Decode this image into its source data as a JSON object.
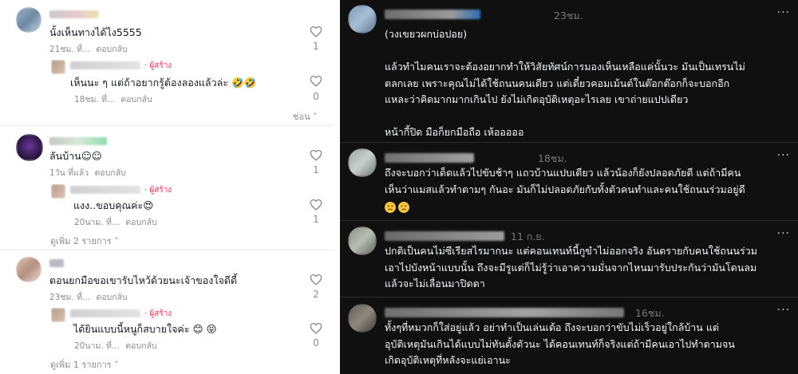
{
  "left_panel": {
    "comments": [
      {
        "username_blurred": true,
        "text": "นั้งเห็นทางได้ไง5555",
        "time": "21ชม. ที่...",
        "reply_label": "ตอบกลับ",
        "likes": "1",
        "replies": [
          {
            "creator_badge": "· ผู้สร้าง",
            "text": "เห็นนะ ๆ แต่ถ้าอยากรู้ต้องลองแล้วล่ะ 🤣🤣",
            "time": "18ชม. ที่...",
            "reply_label": "ตอบกลับ",
            "likes": "0"
          }
        ],
        "hide_label": "ซ่อน ˄"
      },
      {
        "username_blurred": true,
        "text": "ลันบ้าน☺☺",
        "time": "1วัน ที่แล้ว",
        "reply_label": "ตอบกลับ",
        "likes": "1",
        "replies": [
          {
            "creator_badge": "· ผู้สร้าง",
            "text": "แงง..ขอบคุณค่ะ😍",
            "time": "20นาม. ที่...",
            "reply_label": "ตอบกลับ",
            "likes": "1"
          }
        ],
        "more_label": "ดูเพิ่ม 2 รายการ ˅"
      },
      {
        "username_blurred": true,
        "text": "ตอนยกมือขอเขารับไหว้ด้วยนะเจ้าของใจดีดี้",
        "time": "23ชม. ที่...",
        "reply_label": "ตอบกลับ",
        "likes": "2",
        "replies": [
          {
            "creator_badge": "· ผู้สร้าง",
            "text": "ได้ยินแบบนี้หนูก็สบายใจค่ะ 😊 😝",
            "time": "20นาม. ที่...",
            "reply_label": "ตอบกลับ",
            "likes": "0"
          }
        ],
        "more_label": "ดูเพิ่ม 1 รายการ ˅"
      }
    ]
  },
  "right_panel": {
    "posts": [
      {
        "time": "23ชม.",
        "more": "···",
        "lines": [
          "(วงเขยวผกบ่อปอย)",
          "",
          "แล้วทำไมคนเราจะต้องอยากทำให้วิสัยทัศน์การมองเห็นเหลือแค่นั้นวะ มันเป็นเทรนไม่",
          "ตลกเลย เพราะคุณไม่ได้ใช้ถนนคนเดียว แต่เดี๋ยวคอมเม้นต์ในต๊อกต๊อกก็จะบอกอีก",
          "แหละว่าคิดมากมากเกินไป ยังไม่เกิดอุบัติเหตุอะไรเลย เขาถ่ายแปปเดียว",
          "",
          "หน้ากี้ปิด มือก็ยกมือถือ เห้อออออ"
        ]
      },
      {
        "time": "18ชม.",
        "more": "···",
        "lines": [
          "ถึงจะบอกว่าเด็ดแล้วไปขับช้าๆ แถวบ้านแปบเดียว แล้วน้องก็ยังปลอดภัยดี แต่ถ้ามีคน",
          "เห็นว่าแมสแล้วทำตามๆ กันอะ มันก็ไม่ปลอดภัยกับทั้งตัวคนทำและคนใช้ถนนร่วมอยู่ดี"
        ],
        "emoji_count": 2
      },
      {
        "time": "11 ก.ย.",
        "more": "···",
        "lines": [
          "ปกติเป็นคนไม่ซีเรียสไรมากนะ แต่คอนเทนท์นี้กูขำไม่ออกจริง อันตรายกับคนใช้ถนนร่วม",
          "เอาไปบังหน้าแบบนั้น ถึงจะมีรูแต่ก็ไม่รู้ว่าเอาความมั่นจากไหนมารับประกันว่ามันโดนลม",
          "แล้วจะไม่เลื่อนมาปิดตา"
        ]
      },
      {
        "time": "16ชม.",
        "more": "···",
        "lines": [
          "ทั้งๆที่หมวกก็ใส่อยู่แล้ว อย่าทำเป็นเล่นเด้อ ถึงจะบอกว่าขับไม่เร็วอยู่ใกล้บ้าน แต่",
          "อุบัติเหตุมันเกินได้แบบไม่ทันตั้งตัวนะ ได้คอนเทนท์ก็จริงแต่ถ้ามีคนเอาไปทำตามจน",
          "เกิดอุบัติเหตุที่หลังจะแย่เอานะ"
        ]
      }
    ]
  },
  "colors": {
    "left_bg": "#ffffff",
    "right_bg": "#101010",
    "creator_accent": "#fe2c55",
    "meta_grey": "#8a8b91",
    "dark_time": "#777777"
  },
  "icons": [
    "heart-outline-icon",
    "chevron-up-icon",
    "chevron-down-icon",
    "more-dots-icon",
    "sad-face-emoji"
  ]
}
